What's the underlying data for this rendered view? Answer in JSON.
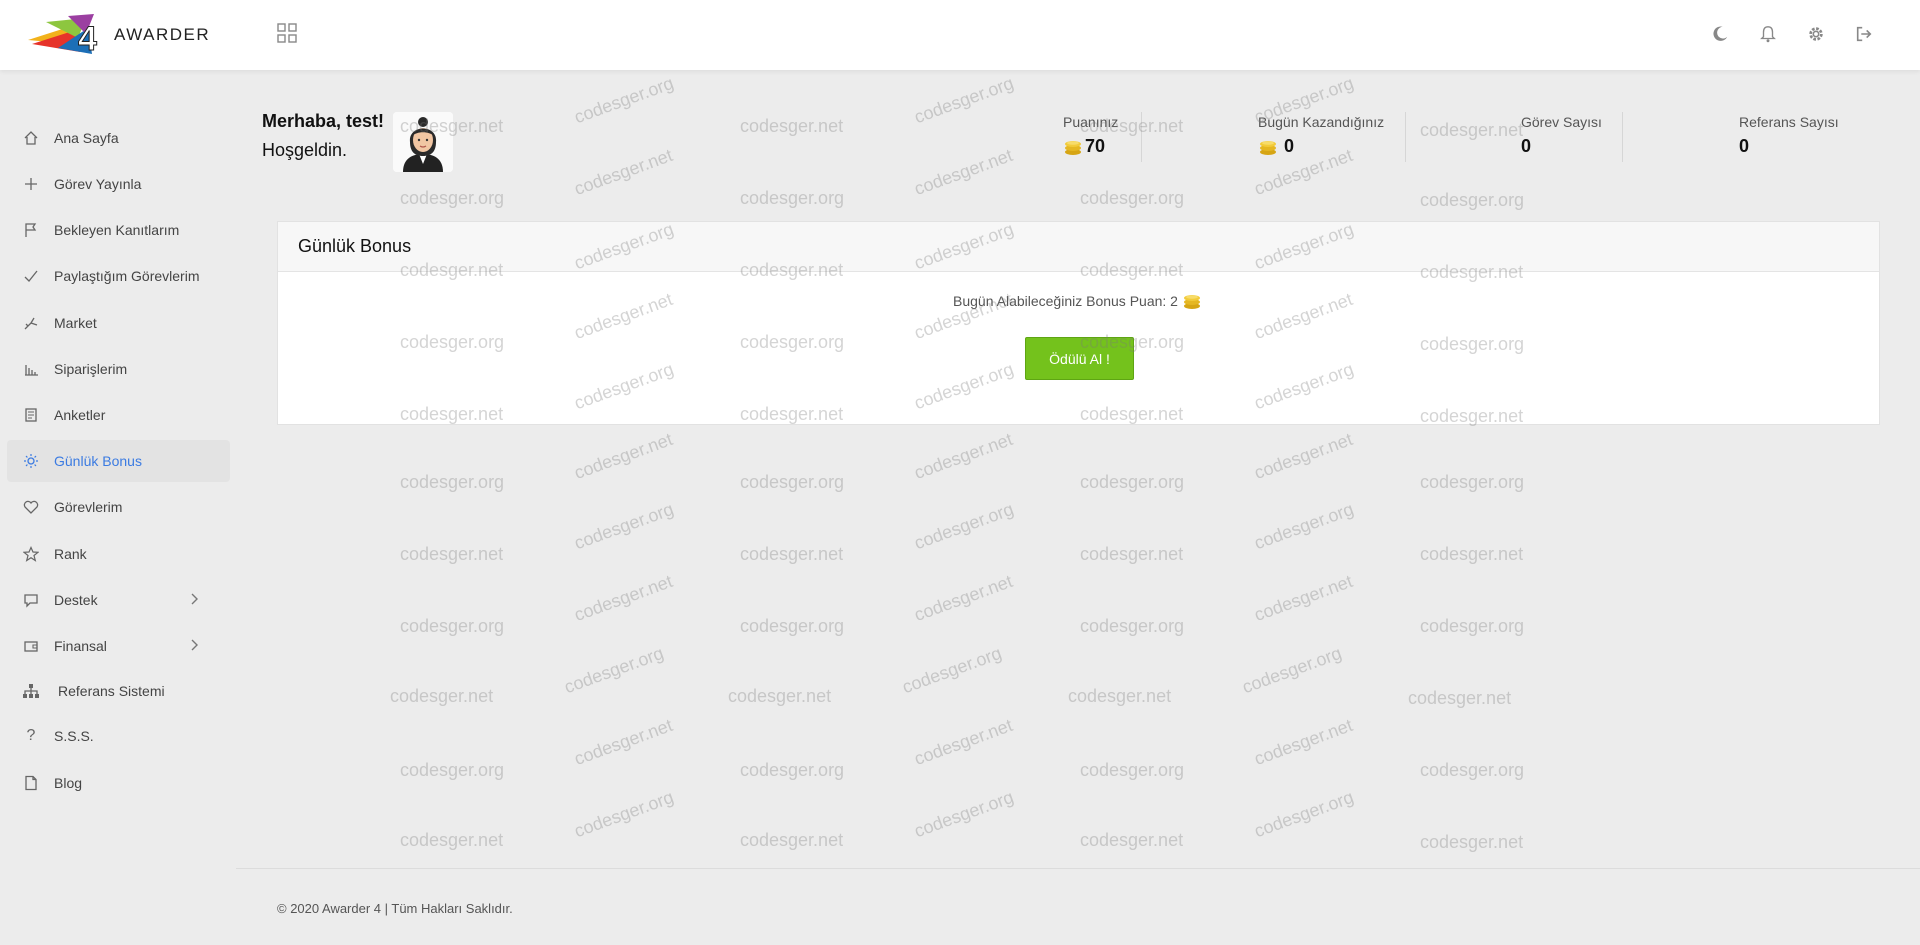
{
  "app": {
    "logo_text": "AWARDER",
    "logo_mark": "4"
  },
  "header": {
    "icons": [
      "moon-icon",
      "bell-icon",
      "gear-icon",
      "logout-icon"
    ]
  },
  "sidebar": {
    "items": [
      {
        "label": "Ana Sayfa",
        "icon": "home-icon"
      },
      {
        "label": "Görev Yayınla",
        "icon": "plus-icon"
      },
      {
        "label": "Bekleyen Kanıtlarım",
        "icon": "flag-icon"
      },
      {
        "label": "Paylaştığım Görevlerim",
        "icon": "check-icon"
      },
      {
        "label": "Market",
        "icon": "market-icon"
      },
      {
        "label": "Siparişlerim",
        "icon": "bar-chart-icon"
      },
      {
        "label": "Anketler",
        "icon": "document-icon"
      },
      {
        "label": "Günlük Bonus",
        "icon": "sun-icon",
        "active": true
      },
      {
        "label": "Görevlerim",
        "icon": "heart-icon"
      },
      {
        "label": "Rank",
        "icon": "star-icon"
      },
      {
        "label": "Destek",
        "icon": "chat-icon",
        "has_children": true
      },
      {
        "label": "Finansal",
        "icon": "wallet-icon",
        "has_children": true
      },
      {
        "label": "Referans Sistemi",
        "icon": "sitemap-icon"
      },
      {
        "label": "S.S.S.",
        "icon": "question-icon"
      },
      {
        "label": "Blog",
        "icon": "file-icon"
      }
    ]
  },
  "greeting": {
    "line1": "Merhaba, test!",
    "line2": "Hoşgeldin."
  },
  "stats": [
    {
      "label": "Puanınız",
      "value": "70",
      "coin": true
    },
    {
      "label": "Bugün Kazandığınız",
      "value": "0",
      "coin": true
    },
    {
      "label": "Görev Sayısı",
      "value": "0",
      "coin": false
    },
    {
      "label": "Referans Sayısı",
      "value": "0",
      "coin": false
    }
  ],
  "bonus_card": {
    "title": "Günlük Bonus",
    "text": "Bugün Alabileceğiniz Bonus Puan: 2",
    "button_label": "Ödülü Al !"
  },
  "footer": {
    "text": "© 2020 Awarder 4 | Tüm Hakları Saklıdır."
  },
  "watermark": {
    "a": "codesger.net",
    "b": "codesger.org"
  },
  "colors": {
    "accent": "#3b7be2",
    "button": "#74c21c",
    "coin": "#e5b722"
  }
}
